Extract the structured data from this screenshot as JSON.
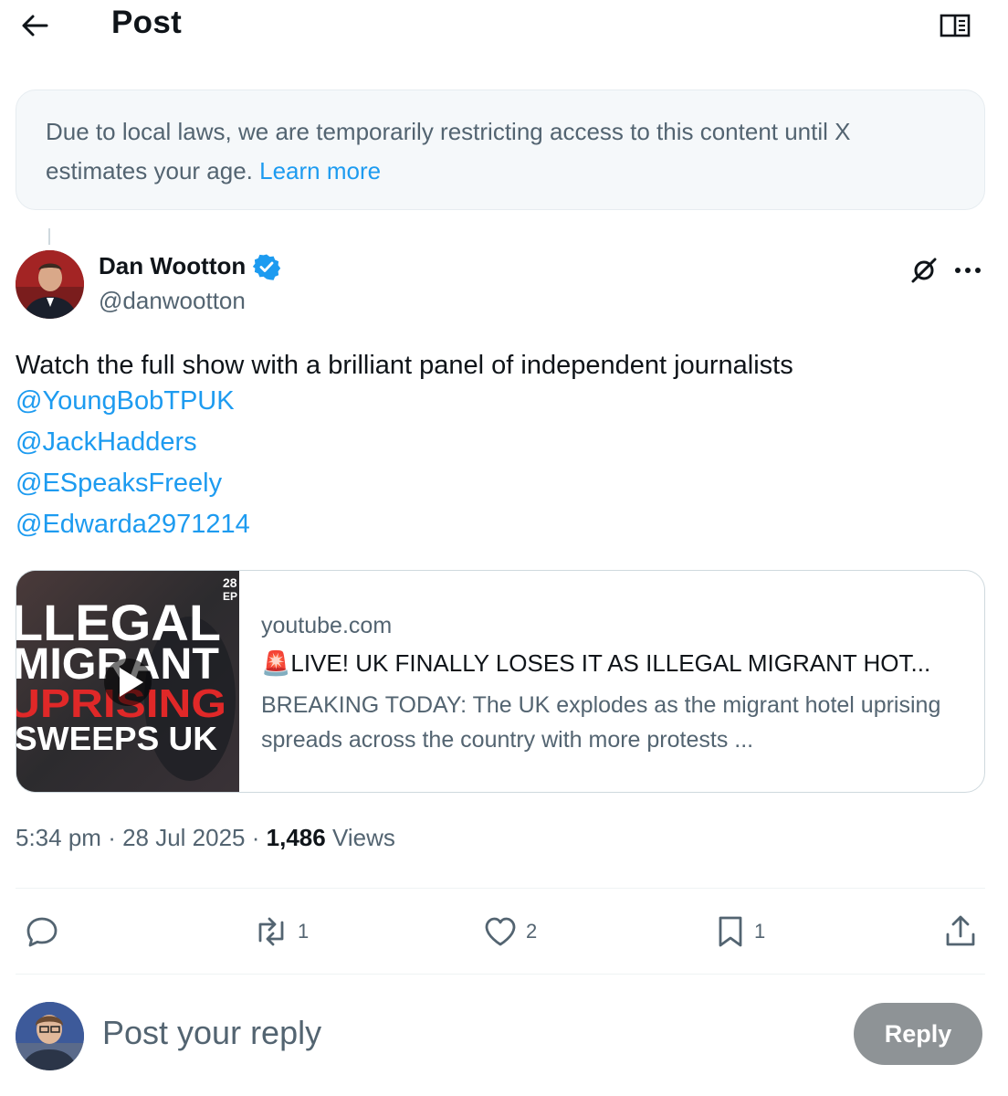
{
  "header": {
    "title": "Post",
    "back_icon": "arrow-left-icon",
    "reader_icon": "reader-mode-icon"
  },
  "notice": {
    "text": "Due to local laws, we are temporarily restricting access to this content until X estimates your age.",
    "link": "Learn more"
  },
  "post": {
    "author_name": "Dan Wootton",
    "author_handle": "@danwootton",
    "verified": true,
    "text": "Watch the full show with a brilliant panel of independent journalists",
    "mentions": [
      "@YoungBobTPUK",
      "@JackHadders",
      "@ESpeaksFreely",
      "@Edwarda2971214"
    ],
    "card": {
      "domain": "youtube.com",
      "title_emoji": "🚨",
      "title": "LIVE! UK FINALLY LOSES IT AS ILLEGAL MIGRANT HOT...",
      "description": "BREAKING TODAY: The UK explodes as the migrant hotel uprising spreads across the country with more protests ...",
      "thumb_lines": [
        "LLEGAL",
        "MIGRANT",
        "UPRISING",
        "SWEEPS UK"
      ],
      "thumb_corner": "28\nEP"
    },
    "time": "5:34 pm",
    "date": "28 Jul 2025",
    "views_count": "1,486",
    "views_label": "Views"
  },
  "actions": {
    "reply_count": "",
    "repost_count": "1",
    "like_count": "2",
    "bookmark_count": "1"
  },
  "composer": {
    "placeholder": "Post your reply",
    "button": "Reply"
  },
  "colors": {
    "accent": "#1d9bf0",
    "muted": "#536471",
    "reply_button": "#8e9396"
  }
}
